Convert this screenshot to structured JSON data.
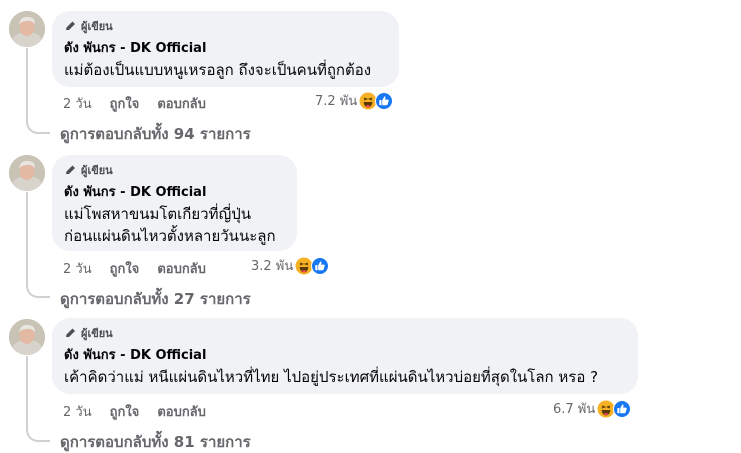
{
  "comments": [
    {
      "badge": "ผู้เขียน",
      "author": "ดัง พันกร - DK Official",
      "lines": [
        "แม่ต้องเป็นแบบหนูเหรอลูก ถึงจะเป็นคนที่ถูกต้อง"
      ],
      "time": "2 วัน",
      "like": "ถูกใจ",
      "reply": "ตอบกลับ",
      "reaction_count": "7.2 พัน",
      "reactions": [
        "haha-icon",
        "like-icon"
      ],
      "view_replies": "ดูการตอบกลับทั้ง 94 รายการ"
    },
    {
      "badge": "ผู้เขียน",
      "author": "ดัง พันกร - DK Official",
      "lines": [
        "แม่โพสหาขนมโตเกียวที่ญี่ปุ่น",
        "ก่อนแผ่นดินไหวตั้งหลายวันนะลูก"
      ],
      "time": "2 วัน",
      "like": "ถูกใจ",
      "reply": "ตอบกลับ",
      "reaction_count": "3.2 พัน",
      "reactions": [
        "haha-icon",
        "like-icon"
      ],
      "view_replies": "ดูการตอบกลับทั้ง 27 รายการ"
    },
    {
      "badge": "ผู้เขียน",
      "author": "ดัง พันกร - DK Official",
      "lines": [
        "เค้าคิดว่าแม่ หนีแผ่นดินไหวที่ไทย ไปอยู่ประเทศที่แผ่นดินไหวบ่อยที่สุดในโลก หรอ ?"
      ],
      "time": "2 วัน",
      "like": "ถูกใจ",
      "reply": "ตอบกลับ",
      "reaction_count": "6.7 พัน",
      "reactions": [
        "haha-icon",
        "like-icon"
      ],
      "view_replies": "ดูการตอบกลับทั้ง 81 รายการ"
    }
  ],
  "colors": {
    "bubble": "#f0f2f5",
    "secondary_text": "#65676b",
    "like_blue": "#1877f2",
    "haha_yellow": "#f7b125",
    "thread_line": "#ced0d4"
  }
}
